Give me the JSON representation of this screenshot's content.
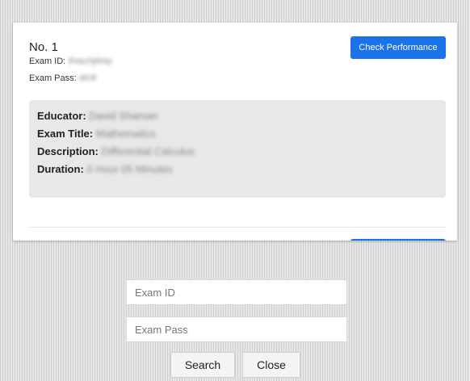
{
  "card": {
    "number_label": "No. 1",
    "exam_id_label": "Exam ID:",
    "exam_id_value": "9Vachj6t4p",
    "exam_pass_label": "Exam Pass:",
    "exam_pass_value": "d03f",
    "check_button_label": "Check Performance",
    "info": {
      "educator_label": "Educator:",
      "educator_value": "David Shaman",
      "title_label": "Exam Title:",
      "title_value": "Mathematics",
      "description_label": "Description:",
      "description_value": "Differential Calculus",
      "duration_label": "Duration:",
      "duration_value": "0 Hour 05 Minutes"
    }
  },
  "search_form": {
    "exam_id_placeholder": "Exam ID",
    "exam_pass_placeholder": "Exam Pass",
    "search_label": "Search",
    "close_label": "Close"
  },
  "colors": {
    "accent": "#1a73e8",
    "info_bg": "#e9e7e8"
  }
}
